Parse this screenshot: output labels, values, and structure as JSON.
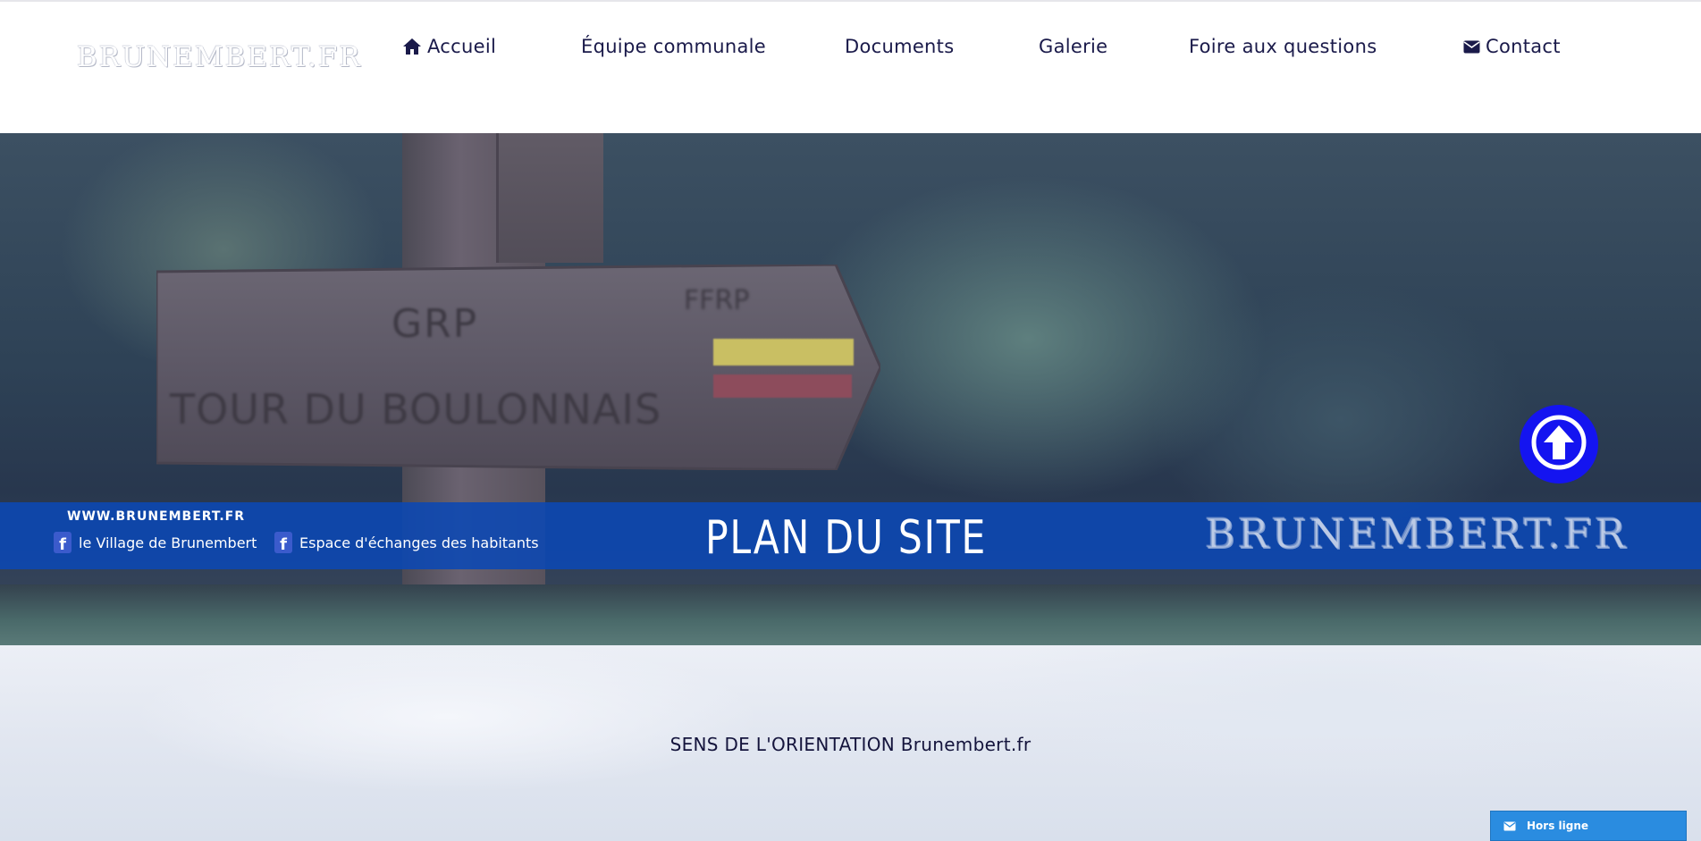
{
  "header": {
    "logo": "BRUNEMBERT.FR",
    "nav": [
      {
        "label": "Accueil",
        "icon": "home-icon"
      },
      {
        "label": "Équipe communale"
      },
      {
        "label": "Documents"
      },
      {
        "label": "Galerie"
      },
      {
        "label": "Foire aux questions"
      },
      {
        "label": "Contact",
        "icon": "envelope-icon"
      }
    ]
  },
  "hero": {
    "sign": {
      "line1": "GRP",
      "line2": "TOUR DU BOULONNAIS",
      "badge": "FFRP"
    },
    "banner": {
      "url": "WWW.BRUNEMBERT.FR",
      "fb_links": [
        "le Village de Brunembert",
        "Espace d'échanges des habitants"
      ],
      "title": "PLAN DU SITE",
      "logo": "BRUNEMBERT.FR"
    },
    "scroll_top_icon": "arrow-up-icon"
  },
  "content": {
    "heading": "SENS DE L'ORIENTATION Brunembert.fr"
  },
  "chat": {
    "label": "Hors ligne",
    "icon": "envelope-icon"
  },
  "colors": {
    "nav_text": "#1a1a4a",
    "banner": "#0b48b4",
    "scroll_button": "#1414f0",
    "chat": "#2a8ce0"
  }
}
